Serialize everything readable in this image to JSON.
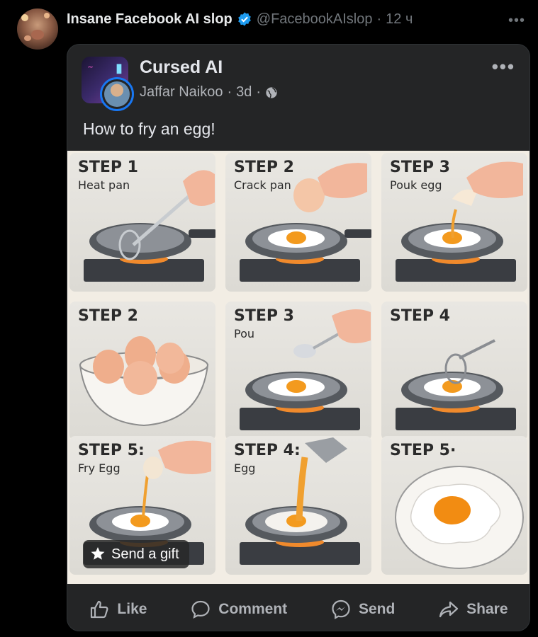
{
  "tweet": {
    "author": "Insane Facebook AI slop",
    "handle": "@FacebookAIslop",
    "separator": "·",
    "time": "12 ч",
    "more_icon": "more-horizontal-icon"
  },
  "fb_post": {
    "page_name": "Cursed AI",
    "poster": "Jaffar Naikoo",
    "age": "3d",
    "privacy_icon": "globe-icon",
    "text": "How to fry an egg!",
    "panels": [
      {
        "step": "STEP 1",
        "sub": "Heat pan"
      },
      {
        "step": "STEP 2",
        "sub": "Crack pan"
      },
      {
        "step": "STEP 3",
        "sub": "Pouk egg"
      },
      {
        "step": "STEP 2",
        "sub": ""
      },
      {
        "step": "STEP 3",
        "sub": "Pou"
      },
      {
        "step": "STEP 4",
        "sub": ""
      },
      {
        "step": "STEP 5:",
        "sub": "Fry Egg"
      },
      {
        "step": "STEP 4:",
        "sub": "Egg"
      },
      {
        "step": "STEP 5·",
        "sub": ""
      }
    ],
    "gift_label": "Send a gift",
    "actions": {
      "like": "Like",
      "comment": "Comment",
      "send": "Send",
      "share": "Share"
    }
  },
  "colors": {
    "background": "#000000",
    "card": "#242526",
    "verified": "#1d9bf0",
    "fb_blue": "#1877f2",
    "muted": "#71767b"
  }
}
